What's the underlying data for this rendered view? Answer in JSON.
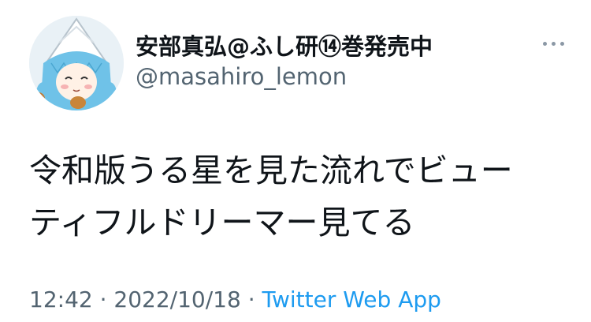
{
  "author": {
    "display_name": "安部真弘@ふし研⑭巻発売中",
    "handle": "@masahiro_lemon",
    "avatar_icon": "squid-girl-avatar-icon"
  },
  "more_button": {
    "icon": "more-horizontal-icon"
  },
  "tweet": {
    "lines": [
      "令和版うる星を見た流れでビュー",
      "ティフルドリーマー見てる"
    ]
  },
  "meta": {
    "time": "12:42",
    "separator1": " · ",
    "date": "2022/10/18",
    "separator2": " · ",
    "source": "Twitter Web App"
  },
  "colors": {
    "text": "#0f1419",
    "secondary": "#536471",
    "link": "#1d9bf0"
  }
}
